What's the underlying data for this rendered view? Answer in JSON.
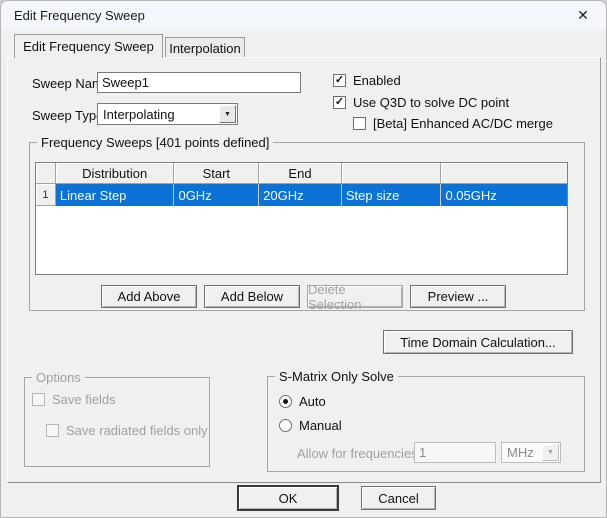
{
  "window": {
    "title": "Edit Frequency Sweep"
  },
  "icons": {
    "close": "✕",
    "check": "✓",
    "dropdown_arrow": "▼"
  },
  "tabs": [
    {
      "label": "Edit Frequency Sweep",
      "active": true
    },
    {
      "label": "Interpolation",
      "active": false
    }
  ],
  "sweep": {
    "name_label": "Sweep Name:",
    "name_value": "Sweep1",
    "type_label": "Sweep Type:",
    "type_value": "Interpolating"
  },
  "checkboxes": {
    "enabled_label": "Enabled",
    "enabled_checked": true,
    "use_q3d_label": "Use Q3D to solve DC point",
    "use_q3d_checked": true,
    "beta_label": "[Beta] Enhanced AC/DC merge",
    "beta_checked": false
  },
  "frequency_sweeps": {
    "group_title": "Frequency Sweeps [401 points defined]",
    "headers": [
      "",
      "Distribution",
      "Start",
      "End",
      "",
      ""
    ],
    "row": {
      "number": "1",
      "distribution": "Linear Step",
      "start": "0GHz",
      "end": "20GHz",
      "col4": "Step size",
      "col5": "0.05GHz",
      "selected": true
    },
    "buttons": {
      "add_above": "Add Above",
      "add_below": "Add Below",
      "delete_selection": "Delete Selection",
      "preview": "Preview ..."
    }
  },
  "time_domain": {
    "button_label": "Time Domain Calculation..."
  },
  "options": {
    "group_title": "Options",
    "save_fields_label": "Save fields",
    "save_fields_checked": false,
    "save_radiated_label": "Save radiated fields only",
    "save_radiated_checked": false
  },
  "s_matrix": {
    "group_title": "S-Matrix Only Solve",
    "auto_label": "Auto",
    "manual_label": "Manual",
    "selected_option": "Auto",
    "allow_label": "Allow for frequencies above",
    "frequency_value": "1",
    "unit_value": "MHz"
  },
  "footer": {
    "ok_label": "OK",
    "cancel_label": "Cancel"
  },
  "colors": {
    "selection_blue": "#0d72d6",
    "titlebar_bg": "#f3f6fa",
    "dialog_bg": "#f0f0ee"
  }
}
